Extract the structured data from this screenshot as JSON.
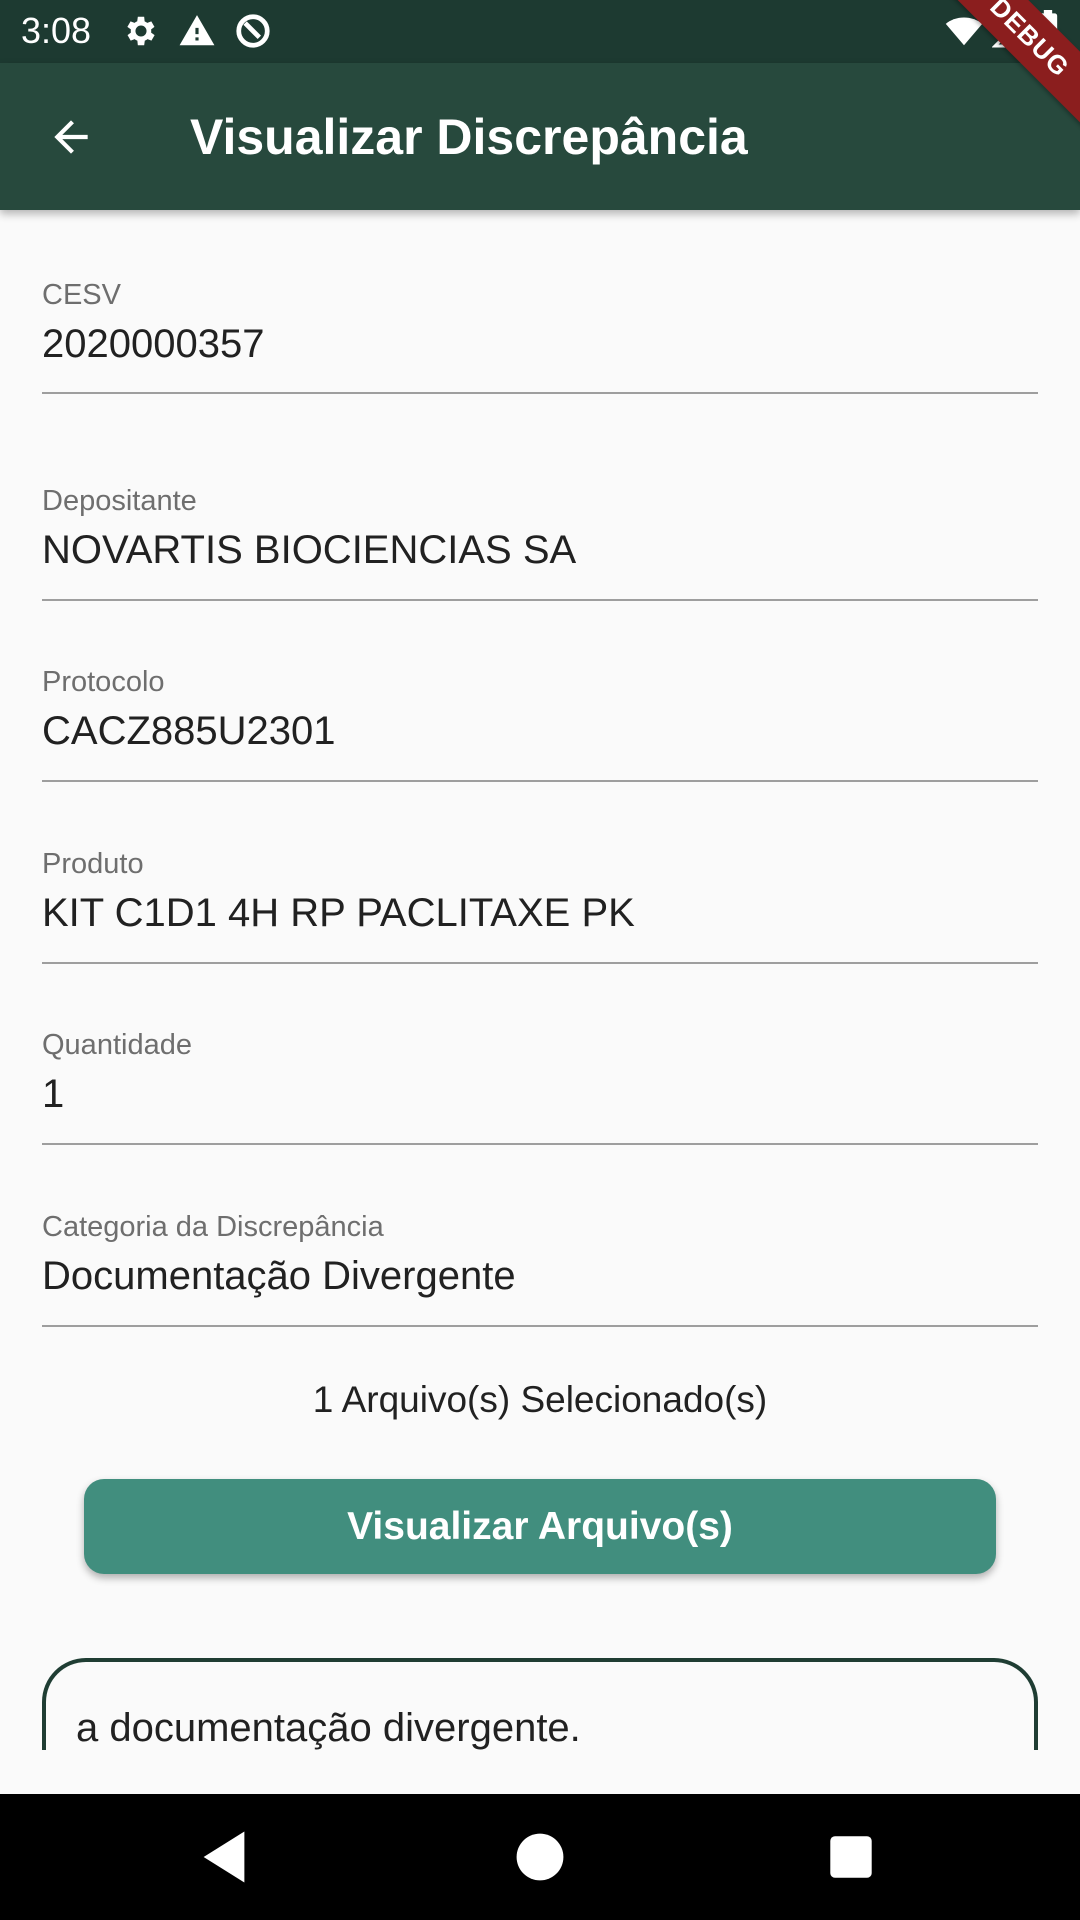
{
  "status_bar": {
    "time": "3:08",
    "left_icons": [
      "gear-icon",
      "warning-icon",
      "data-saver-icon"
    ],
    "right_icons": [
      "wifi-icon",
      "cell-signal-icon",
      "battery-icon"
    ]
  },
  "debug_banner": {
    "label": "DEBUG",
    "color": "#8b1e1e"
  },
  "app_bar": {
    "title": "Visualizar Discrepância",
    "back_icon": "arrow-back-icon",
    "color": "#27493d"
  },
  "fields": {
    "cesv": {
      "label": "CESV",
      "value": "2020000357"
    },
    "depositante": {
      "label": "Depositante",
      "value": "NOVARTIS BIOCIENCIAS SA"
    },
    "protocolo": {
      "label": "Protocolo",
      "value": "CACZ885U2301"
    },
    "produto": {
      "label": "Produto",
      "value": "KIT C1D1 4H RP PACLITAXE PK"
    },
    "quantidade": {
      "label": "Quantidade",
      "value": "1"
    },
    "categoria": {
      "label": "Categoria da Discrepância",
      "value": "Documentação Divergente"
    }
  },
  "files": {
    "count_text": "1 Arquivo(s) Selecionado(s)",
    "view_button_label": "Visualizar Arquivo(s)",
    "button_color": "#418e7e"
  },
  "description": {
    "text": "a documentação divergente."
  },
  "nav_bar": {
    "icons": [
      "nav-back-icon",
      "nav-home-icon",
      "nav-recents-icon"
    ]
  }
}
